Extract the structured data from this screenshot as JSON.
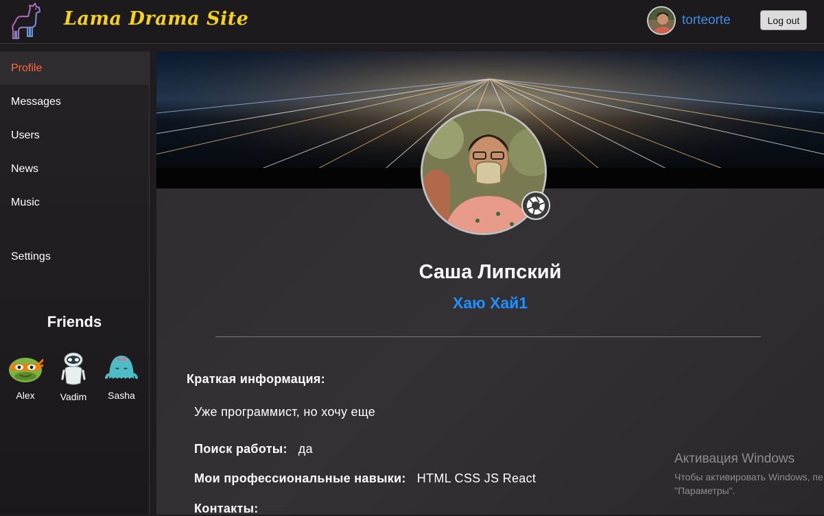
{
  "header": {
    "logo_icon": "llama-icon",
    "site_title": "Lama Drama Site",
    "username": "torteorte",
    "logout_label": "Log out"
  },
  "sidebar": {
    "items": [
      {
        "label": "Profile",
        "active": true
      },
      {
        "label": "Messages"
      },
      {
        "label": "Users"
      },
      {
        "label": "News"
      },
      {
        "label": "Music"
      },
      {
        "label": "Settings"
      }
    ],
    "friends_title": "Friends",
    "friends": [
      {
        "name": "Alex",
        "icon": "turtle-avatar-icon"
      },
      {
        "name": "Vadim",
        "icon": "robot-avatar-icon"
      },
      {
        "name": "Sasha",
        "icon": "octopus-avatar-icon"
      }
    ]
  },
  "profile": {
    "name": "Саша Липский",
    "status": "Хаю Хай1",
    "brief_label": "Краткая информация:",
    "brief_value": "Уже программист, но хочу еще",
    "job_label": "Поиск работы:",
    "job_value": "да",
    "skills_label": "Мои профессиональные навыки:",
    "skills_value": "HTML CSS JS React",
    "contacts_label": "Контакты:"
  },
  "watermark": {
    "title": "Активация Windows",
    "line1": "Чтобы активировать Windows, пе",
    "line2": "\"Параметры\"."
  },
  "colors": {
    "accent_active": "#ff6a3c",
    "status_blue": "#1e90ff",
    "username_blue": "#3d8de0",
    "title_yellow": "#f5d21a"
  }
}
